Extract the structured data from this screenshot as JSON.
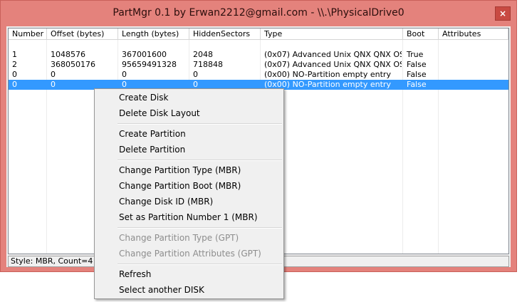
{
  "window": {
    "title": "PartMgr 0.1 by Erwan2212@gmail.com - \\\\.\\PhysicalDrive0",
    "close_symbol": "×"
  },
  "table": {
    "columns": [
      "Number",
      "Offset (bytes)",
      "Length (bytes)",
      "HiddenSectors",
      "Type",
      "Boot",
      "Attributes"
    ],
    "rows": [
      [
        "1",
        "1048576",
        "367001600",
        "2048",
        "(0x07) Advanced Unix QNX QNX OS...",
        "True",
        ""
      ],
      [
        "2",
        "368050176",
        "95659491328",
        "718848",
        "(0x07) Advanced Unix QNX QNX OS...",
        "False",
        ""
      ],
      [
        "0",
        "0",
        "0",
        "0",
        "(0x00) NO-Partition empty entry",
        "False",
        ""
      ],
      [
        "0",
        "0",
        "0",
        "0",
        "(0x00) NO-Partition empty entry",
        "False",
        ""
      ]
    ],
    "selected_row": 3
  },
  "statusbar": {
    "text": "Style: MBR, Count=4"
  },
  "context_menu": {
    "items": [
      {
        "label": "Create Disk",
        "enabled": true
      },
      {
        "label": "Delete Disk Layout",
        "enabled": true
      },
      {
        "label": "Create Partition",
        "enabled": true
      },
      {
        "label": "Delete Partition",
        "enabled": true
      },
      {
        "label": "Change Partition Type (MBR)",
        "enabled": true
      },
      {
        "label": "Change Partition Boot (MBR)",
        "enabled": true
      },
      {
        "label": "Change Disk ID (MBR)",
        "enabled": true
      },
      {
        "label": "Set as Partition Number 1 (MBR)",
        "enabled": true
      },
      {
        "label": "Change Partition Type (GPT)",
        "enabled": false
      },
      {
        "label": "Change Partition Attributes (GPT)",
        "enabled": false
      },
      {
        "label": "Refresh",
        "enabled": true
      },
      {
        "label": "Select another DISK",
        "enabled": true
      }
    ]
  },
  "colors": {
    "title_bar": "#e4827c",
    "close_button": "#c84a42",
    "selection": "#3399ff",
    "disabled_text": "#8d8d8d"
  }
}
